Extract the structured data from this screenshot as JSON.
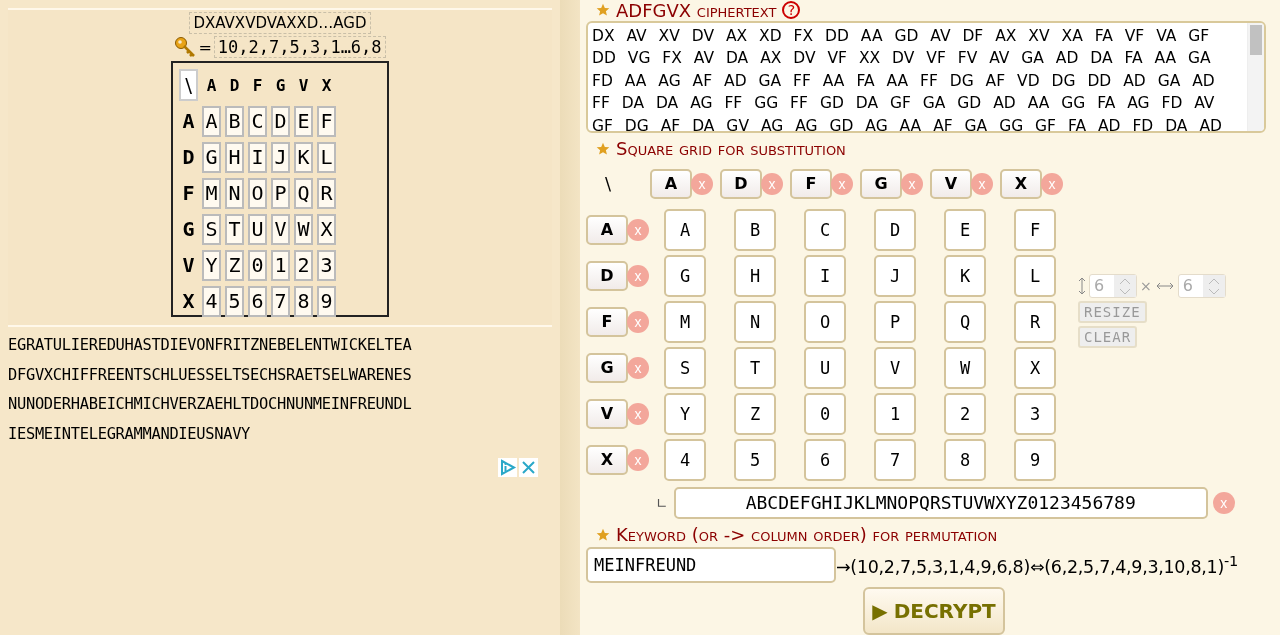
{
  "preview": {
    "ciphertext": "DXAVXVDVAXXD…AGD",
    "equals": "=",
    "key": "10,2,7,5,3,1…6,8",
    "corner": "\\",
    "col_headers": [
      "A",
      "D",
      "F",
      "G",
      "V",
      "X"
    ],
    "rows": [
      {
        "header": "A",
        "cells": [
          "A",
          "B",
          "C",
          "D",
          "E",
          "F"
        ]
      },
      {
        "header": "D",
        "cells": [
          "G",
          "H",
          "I",
          "J",
          "K",
          "L"
        ]
      },
      {
        "header": "F",
        "cells": [
          "M",
          "N",
          "O",
          "P",
          "Q",
          "R"
        ]
      },
      {
        "header": "G",
        "cells": [
          "S",
          "T",
          "U",
          "V",
          "W",
          "X"
        ]
      },
      {
        "header": "V",
        "cells": [
          "Y",
          "Z",
          "0",
          "1",
          "2",
          "3"
        ]
      },
      {
        "header": "X",
        "cells": [
          "4",
          "5",
          "6",
          "7",
          "8",
          "9"
        ]
      }
    ]
  },
  "plaintext_lines": [
    "EGRATULIEREDUHASTDIEVONFRITZNEBELENTWICKELTEA",
    "DFGVXCHIFFREENTSCHLUESSELTSECHSRAETSELWARENES",
    "NUNODERHABEICHMICHVERZAEHLTDOCHNUNMEINFREUNDL",
    "IESMEINTELEGRAMMANDIEUSNAVY"
  ],
  "ciphertext_section": {
    "title": "ADFGVX ciphertext",
    "help": "?",
    "lines": [
      "DX AV XV DV AX XD FX DD AA GD AV DF AX XV XA FA VF VA GF",
      "DD VG FX AV DA AX DV VF XX DV VF FV AV GA AD DA FA AA GA",
      "FD AA AG AF AD GA FF AA FA AA FF DG AF VD DG DD AD GA AD",
      "FF DA DA AG FF GG FF GD DA GF GA GD AD AA GG FA AG FD AV",
      "GF DG AF DA GV AG AG GD AG AA AF GA GG GF FA AD FD DA AD"
    ]
  },
  "square_section": {
    "title": "Square grid for substitution",
    "corner": "\\",
    "col_headers": [
      {
        "label": "A",
        "remove": "x"
      },
      {
        "label": "D",
        "remove": "x"
      },
      {
        "label": "F",
        "remove": "x"
      },
      {
        "label": "G",
        "remove": "x"
      },
      {
        "label": "V",
        "remove": "x"
      },
      {
        "label": "X",
        "remove": "x"
      }
    ],
    "rows": [
      {
        "header": "A",
        "remove": "x",
        "cells": [
          "A",
          "B",
          "C",
          "D",
          "E",
          "F"
        ]
      },
      {
        "header": "D",
        "remove": "x",
        "cells": [
          "G",
          "H",
          "I",
          "J",
          "K",
          "L"
        ]
      },
      {
        "header": "F",
        "remove": "x",
        "cells": [
          "M",
          "N",
          "O",
          "P",
          "Q",
          "R"
        ]
      },
      {
        "header": "G",
        "remove": "x",
        "cells": [
          "S",
          "T",
          "U",
          "V",
          "W",
          "X"
        ]
      },
      {
        "header": "V",
        "remove": "x",
        "cells": [
          "Y",
          "Z",
          "0",
          "1",
          "2",
          "3"
        ]
      },
      {
        "header": "X",
        "remove": "x",
        "cells": [
          "4",
          "5",
          "6",
          "7",
          "8",
          "9"
        ]
      }
    ],
    "rows_count": "6",
    "times": "×",
    "cols_count": "6",
    "resize": "RESIZE",
    "clear": "CLEAR",
    "corner_mark": "∟",
    "alphabet": "ABCDEFGHIJKLMNOPQRSTUVWXYZ0123456789",
    "alphabet_remove": "x"
  },
  "keyword_section": {
    "title": "Keyword (or -> column order) for permutation",
    "value": "MEINFREUND",
    "order": "→(10,2,7,5,3,1,4,9,6,8)⇔(6,2,5,7,4,9,3,10,8,1)$^{-1}$"
  },
  "decrypt_button": {
    "icon": "▶",
    "label": "DECRYPT"
  }
}
